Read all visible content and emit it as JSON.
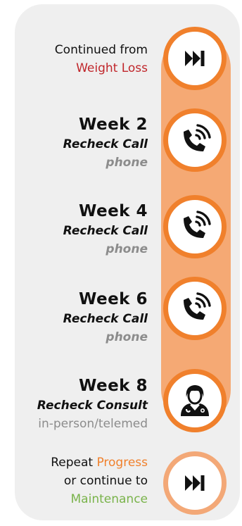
{
  "timeline": {
    "start": {
      "line1": "Continued from",
      "line2": "Weight Loss",
      "line2_color": "#c0262b",
      "icon": "skip-forward-icon"
    },
    "steps": [
      {
        "week": "Week 2",
        "type": "Recheck Call",
        "mode": "phone",
        "icon": "phone-icon"
      },
      {
        "week": "Week 4",
        "type": "Recheck Call",
        "mode": "phone",
        "icon": "phone-icon"
      },
      {
        "week": "Week 6",
        "type": "Recheck Call",
        "mode": "phone",
        "icon": "phone-icon"
      },
      {
        "week": "Week 8",
        "type": "Recheck Consult",
        "mode": "in-person/telemed",
        "icon": "doctor-icon"
      }
    ],
    "end": {
      "repeat_text": "Repeat",
      "repeat_link": "Progress",
      "continue_text": "or continue to",
      "continue_link": "Maintenance",
      "repeat_link_color": "#f0802c",
      "continue_link_color": "#79b34a",
      "icon": "skip-forward-icon"
    }
  },
  "colors": {
    "panel_bg": "#efefef",
    "track": "#f5a974",
    "ring": "#f0802c",
    "ring_light": "#f3a877",
    "muted_text": "#8c8c8c"
  }
}
